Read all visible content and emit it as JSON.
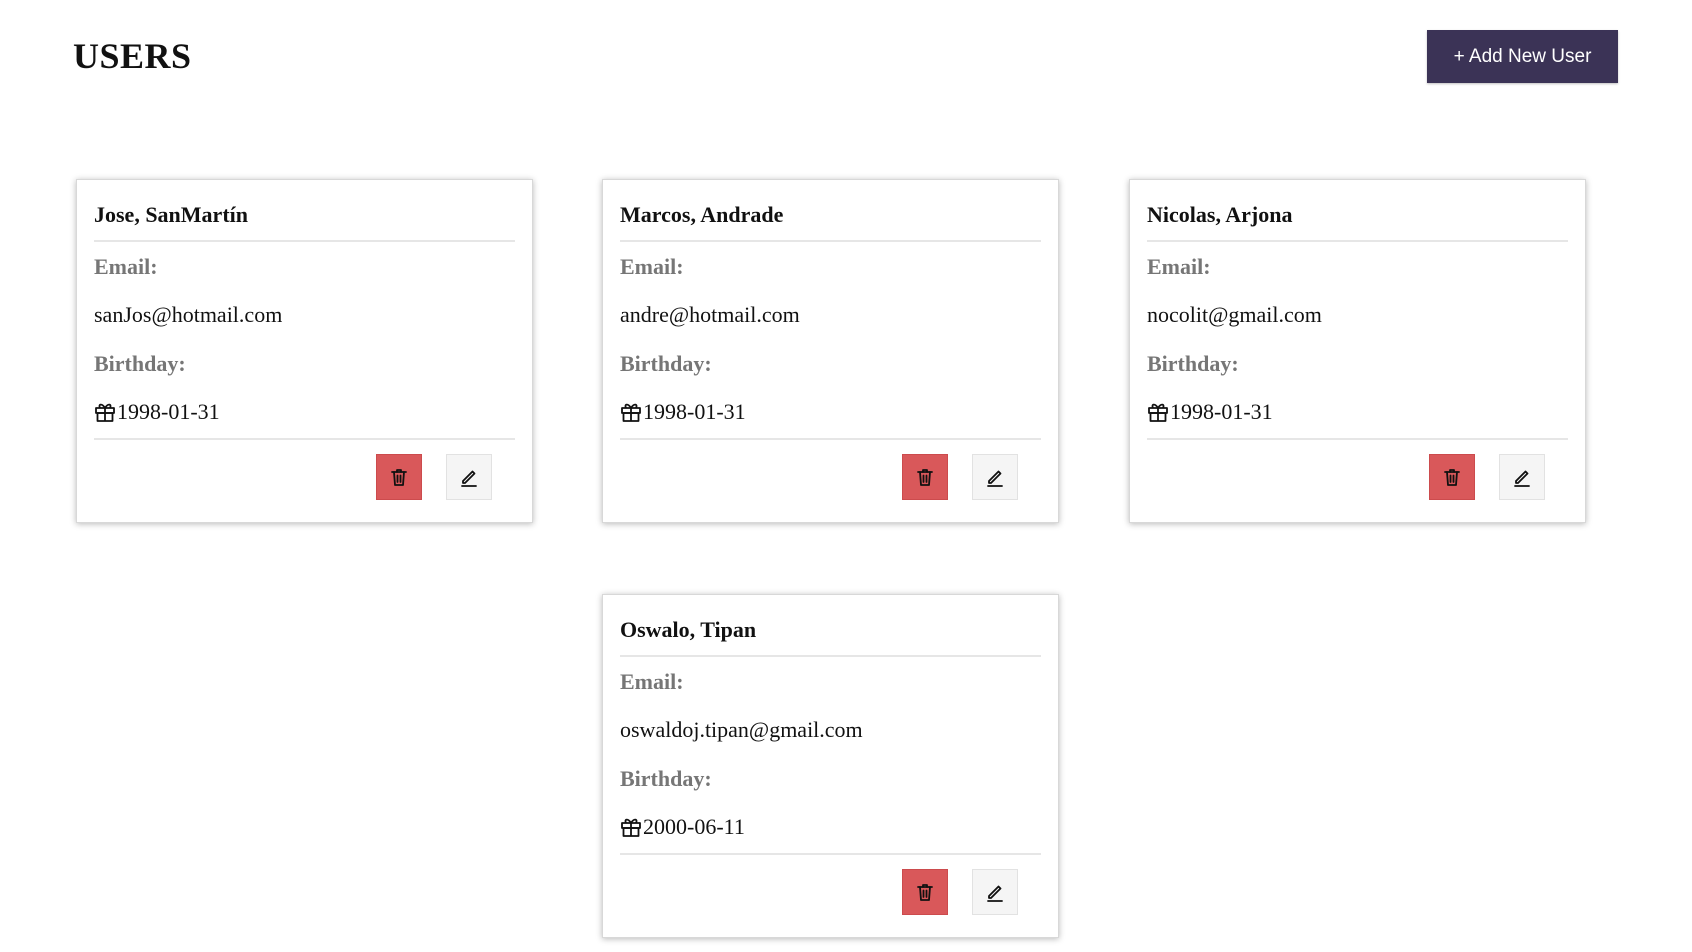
{
  "page": {
    "title": "USERS",
    "add_button_label": "+ Add New User"
  },
  "colors": {
    "primary": "#3b3356",
    "danger": "#d9585a",
    "label_gray": "#767676"
  },
  "labels": {
    "email": "Email:",
    "birthday": "Birthday:"
  },
  "icons": {
    "birthday": "gift-icon",
    "delete": "trash-icon",
    "edit": "pencil-icon"
  },
  "users": [
    {
      "name": "Jose, SanMartín",
      "email": "sanJos@hotmail.com",
      "birthday": "1998-01-31"
    },
    {
      "name": "Marcos, Andrade",
      "email": "andre@hotmail.com",
      "birthday": "1998-01-31"
    },
    {
      "name": "Nicolas, Arjona",
      "email": "nocolit@gmail.com",
      "birthday": "1998-01-31"
    },
    {
      "name": "Oswalo, Tipan",
      "email": "oswaldoj.tipan@gmail.com",
      "birthday": "2000-06-11"
    }
  ]
}
